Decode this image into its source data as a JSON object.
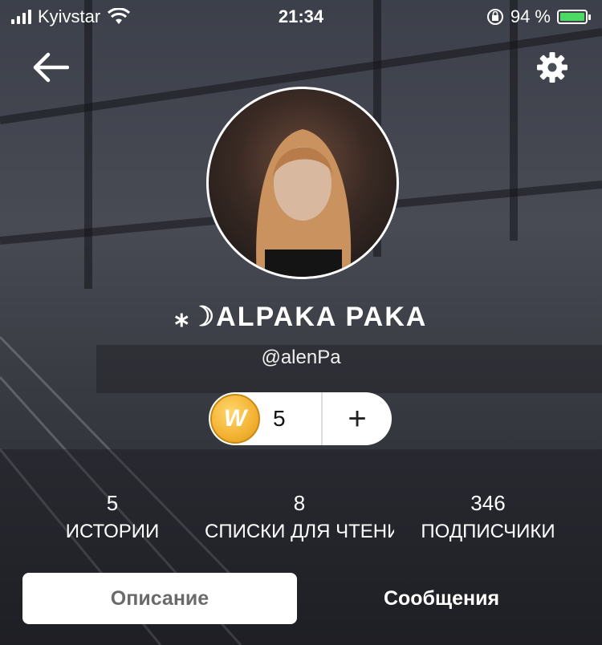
{
  "status": {
    "carrier": "Kyivstar",
    "time": "21:34",
    "battery": "94 %",
    "battery_level": 0.94
  },
  "nav": {
    "back_icon": "arrow-left-icon",
    "settings_icon": "gear-icon"
  },
  "profile": {
    "display_name": "⁎☽ALPAKA PAKA",
    "username": "@alenPa"
  },
  "coins": {
    "count": "5",
    "add_label": "+"
  },
  "stats": [
    {
      "value": "5",
      "label": "ИСТОРИИ"
    },
    {
      "value": "8",
      "label": "СПИСКИ ДЛЯ ЧТЕНИ"
    },
    {
      "value": "346",
      "label": "ПОДПИСЧИКИ"
    }
  ],
  "tabs": {
    "description": "Описание",
    "messages": "Сообщения"
  }
}
